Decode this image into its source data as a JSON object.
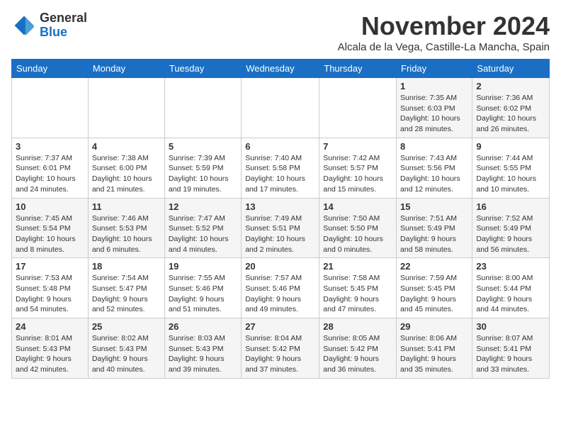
{
  "logo": {
    "general": "General",
    "blue": "Blue"
  },
  "header": {
    "month": "November 2024",
    "location": "Alcala de la Vega, Castille-La Mancha, Spain"
  },
  "weekdays": [
    "Sunday",
    "Monday",
    "Tuesday",
    "Wednesday",
    "Thursday",
    "Friday",
    "Saturday"
  ],
  "weeks": [
    [
      {
        "day": "",
        "info": ""
      },
      {
        "day": "",
        "info": ""
      },
      {
        "day": "",
        "info": ""
      },
      {
        "day": "",
        "info": ""
      },
      {
        "day": "",
        "info": ""
      },
      {
        "day": "1",
        "info": "Sunrise: 7:35 AM\nSunset: 6:03 PM\nDaylight: 10 hours and 28 minutes."
      },
      {
        "day": "2",
        "info": "Sunrise: 7:36 AM\nSunset: 6:02 PM\nDaylight: 10 hours and 26 minutes."
      }
    ],
    [
      {
        "day": "3",
        "info": "Sunrise: 7:37 AM\nSunset: 6:01 PM\nDaylight: 10 hours and 24 minutes."
      },
      {
        "day": "4",
        "info": "Sunrise: 7:38 AM\nSunset: 6:00 PM\nDaylight: 10 hours and 21 minutes."
      },
      {
        "day": "5",
        "info": "Sunrise: 7:39 AM\nSunset: 5:59 PM\nDaylight: 10 hours and 19 minutes."
      },
      {
        "day": "6",
        "info": "Sunrise: 7:40 AM\nSunset: 5:58 PM\nDaylight: 10 hours and 17 minutes."
      },
      {
        "day": "7",
        "info": "Sunrise: 7:42 AM\nSunset: 5:57 PM\nDaylight: 10 hours and 15 minutes."
      },
      {
        "day": "8",
        "info": "Sunrise: 7:43 AM\nSunset: 5:56 PM\nDaylight: 10 hours and 12 minutes."
      },
      {
        "day": "9",
        "info": "Sunrise: 7:44 AM\nSunset: 5:55 PM\nDaylight: 10 hours and 10 minutes."
      }
    ],
    [
      {
        "day": "10",
        "info": "Sunrise: 7:45 AM\nSunset: 5:54 PM\nDaylight: 10 hours and 8 minutes."
      },
      {
        "day": "11",
        "info": "Sunrise: 7:46 AM\nSunset: 5:53 PM\nDaylight: 10 hours and 6 minutes."
      },
      {
        "day": "12",
        "info": "Sunrise: 7:47 AM\nSunset: 5:52 PM\nDaylight: 10 hours and 4 minutes."
      },
      {
        "day": "13",
        "info": "Sunrise: 7:49 AM\nSunset: 5:51 PM\nDaylight: 10 hours and 2 minutes."
      },
      {
        "day": "14",
        "info": "Sunrise: 7:50 AM\nSunset: 5:50 PM\nDaylight: 10 hours and 0 minutes."
      },
      {
        "day": "15",
        "info": "Sunrise: 7:51 AM\nSunset: 5:49 PM\nDaylight: 9 hours and 58 minutes."
      },
      {
        "day": "16",
        "info": "Sunrise: 7:52 AM\nSunset: 5:49 PM\nDaylight: 9 hours and 56 minutes."
      }
    ],
    [
      {
        "day": "17",
        "info": "Sunrise: 7:53 AM\nSunset: 5:48 PM\nDaylight: 9 hours and 54 minutes."
      },
      {
        "day": "18",
        "info": "Sunrise: 7:54 AM\nSunset: 5:47 PM\nDaylight: 9 hours and 52 minutes."
      },
      {
        "day": "19",
        "info": "Sunrise: 7:55 AM\nSunset: 5:46 PM\nDaylight: 9 hours and 51 minutes."
      },
      {
        "day": "20",
        "info": "Sunrise: 7:57 AM\nSunset: 5:46 PM\nDaylight: 9 hours and 49 minutes."
      },
      {
        "day": "21",
        "info": "Sunrise: 7:58 AM\nSunset: 5:45 PM\nDaylight: 9 hours and 47 minutes."
      },
      {
        "day": "22",
        "info": "Sunrise: 7:59 AM\nSunset: 5:45 PM\nDaylight: 9 hours and 45 minutes."
      },
      {
        "day": "23",
        "info": "Sunrise: 8:00 AM\nSunset: 5:44 PM\nDaylight: 9 hours and 44 minutes."
      }
    ],
    [
      {
        "day": "24",
        "info": "Sunrise: 8:01 AM\nSunset: 5:43 PM\nDaylight: 9 hours and 42 minutes."
      },
      {
        "day": "25",
        "info": "Sunrise: 8:02 AM\nSunset: 5:43 PM\nDaylight: 9 hours and 40 minutes."
      },
      {
        "day": "26",
        "info": "Sunrise: 8:03 AM\nSunset: 5:43 PM\nDaylight: 9 hours and 39 minutes."
      },
      {
        "day": "27",
        "info": "Sunrise: 8:04 AM\nSunset: 5:42 PM\nDaylight: 9 hours and 37 minutes."
      },
      {
        "day": "28",
        "info": "Sunrise: 8:05 AM\nSunset: 5:42 PM\nDaylight: 9 hours and 36 minutes."
      },
      {
        "day": "29",
        "info": "Sunrise: 8:06 AM\nSunset: 5:41 PM\nDaylight: 9 hours and 35 minutes."
      },
      {
        "day": "30",
        "info": "Sunrise: 8:07 AM\nSunset: 5:41 PM\nDaylight: 9 hours and 33 minutes."
      }
    ]
  ]
}
